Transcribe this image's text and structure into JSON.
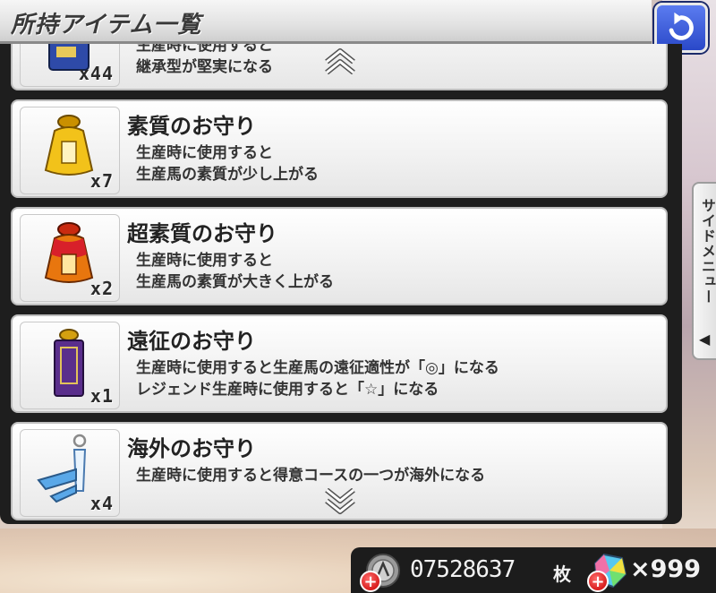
{
  "title": "所持アイテム一覧",
  "back_icon": "undo-arrow-icon",
  "items": [
    {
      "name": "",
      "desc_lines": [
        "生産時に使用すると",
        "継承型が堅実になる"
      ],
      "qty": "x44",
      "icon": "book-charm-icon",
      "color": "#2e4aa8"
    },
    {
      "name": "素質のお守り",
      "desc_lines": [
        "生産時に使用すると",
        "生産馬の素質が少し上がる"
      ],
      "qty": "x7",
      "icon": "gold-charm-icon",
      "color": "#f0b400"
    },
    {
      "name": "超素質のお守り",
      "desc_lines": [
        "生産時に使用すると",
        "生産馬の素質が大きく上がる"
      ],
      "qty": "x2",
      "icon": "red-gold-charm-icon",
      "color": "#e23a1a"
    },
    {
      "name": "遠征のお守り",
      "desc_lines": [
        "生産時に使用すると生産馬の遠征適性が「◎」になる",
        "レジェンド生産時に使用すると「☆」になる"
      ],
      "qty": "x1",
      "icon": "purple-charm-icon",
      "color": "#5a2e8c"
    },
    {
      "name": "海外のお守り",
      "desc_lines": [
        "生産時に使用すると得意コースの一つが海外になる"
      ],
      "qty": "x4",
      "icon": "airplane-charm-icon",
      "color": "#5aa8e8"
    }
  ],
  "side_menu": {
    "label": "サイドメニュー",
    "arrow": "◀"
  },
  "currency": {
    "coins": "07528637",
    "coins_unit": "枚",
    "jewels": "×999",
    "plus": "+"
  },
  "colors": {
    "panel": "#1e1e1e",
    "back_button": "#2a48c8",
    "plus": "#d81e1e"
  }
}
